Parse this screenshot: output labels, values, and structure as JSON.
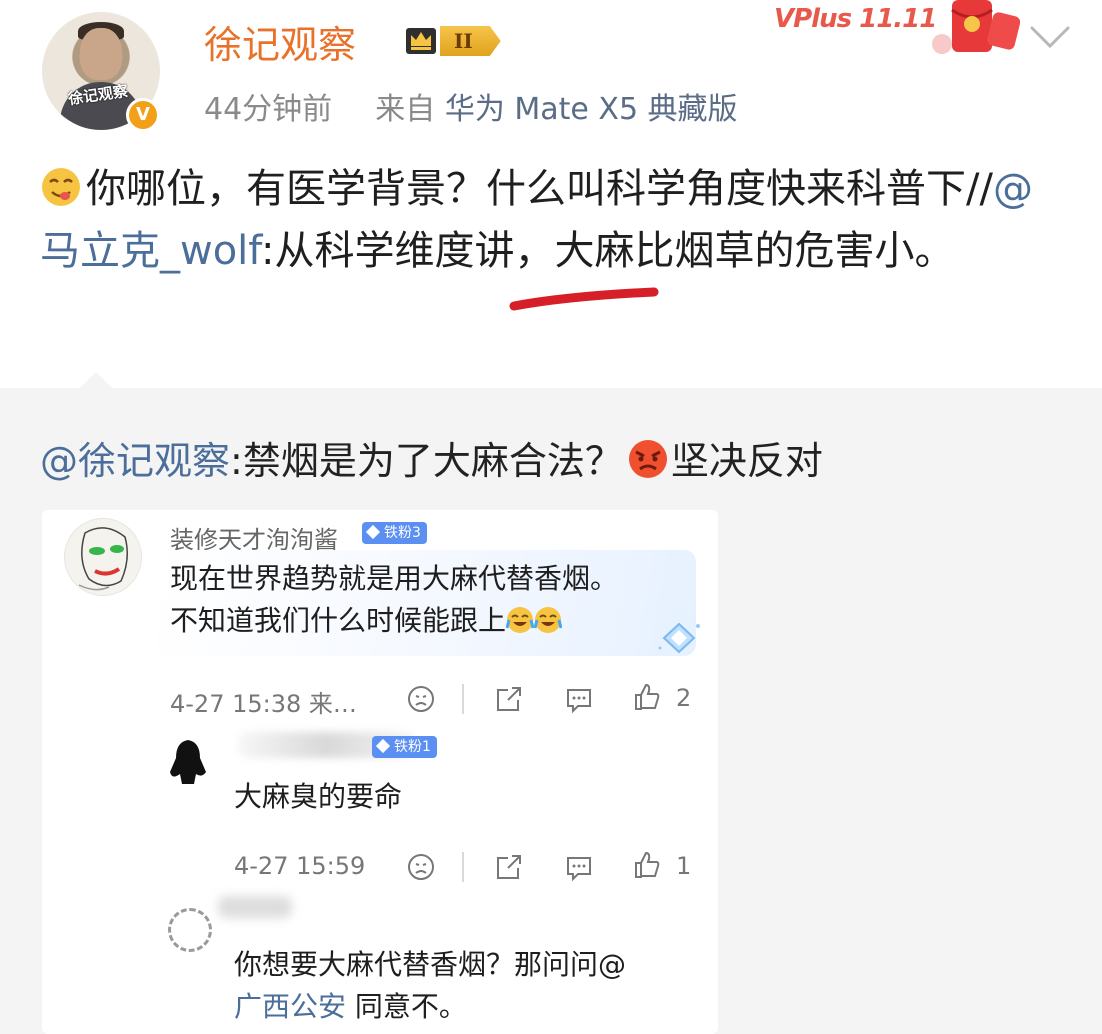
{
  "post": {
    "username": "徐记观察",
    "level_badge": "II",
    "time": "44分钟前",
    "source_prefix": "来自",
    "device": "华为 Mate X5 典藏版",
    "vplus_label": "VPlus 11.11",
    "avatar_stamp": "徐记观察",
    "verified_mark": "V",
    "text_part1": "你哪位，有医学背景？什么叫科学角度快来科普下//",
    "mention": "@马立克_wolf",
    "text_part2": ":从科学维度讲，大麻比烟草的危害小。"
  },
  "repost": {
    "mention": "@徐记观察",
    "text1": ":禁烟是为了大麻合法？",
    "text2": "坚决反对"
  },
  "comments": [
    {
      "name": "装修天才洵洵酱",
      "badge": "铁粉3",
      "line1": "现在世界趋势就是用大麻代替香烟。",
      "line2": "不知道我们什么时候能跟上",
      "time": "4-27 15:38 来…",
      "likes": "2"
    },
    {
      "badge": "铁粉1",
      "text": "大麻臭的要命",
      "time": "4-27 15:59",
      "likes": "1"
    },
    {
      "line1": "你想要大麻代替香烟？那问问@",
      "line2_link": "广西公安",
      "line2_rest": " 同意不。"
    }
  ],
  "colors": {
    "username_orange": "#e8722a",
    "link_blue": "#4b6e9a",
    "badge_blue": "#5b8ff2",
    "underline_red": "#d61f26"
  }
}
